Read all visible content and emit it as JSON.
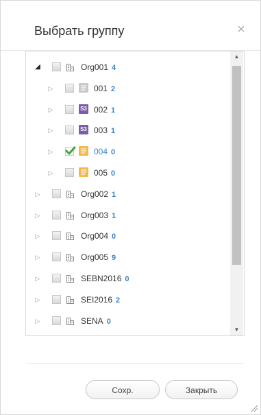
{
  "dialog": {
    "title": "Выбрать группу",
    "close_glyph": "×"
  },
  "tree": [
    {
      "level": 0,
      "expanded": true,
      "checked": false,
      "icon": "building-icon",
      "label": "Org001",
      "count": "4",
      "selected": false
    },
    {
      "level": 1,
      "expanded": false,
      "checked": false,
      "icon": "doc-gray-icon",
      "label": "001",
      "count": "2",
      "selected": false
    },
    {
      "level": 1,
      "expanded": false,
      "checked": false,
      "icon": "s3-icon",
      "label": "002",
      "count": "1",
      "selected": false
    },
    {
      "level": 1,
      "expanded": false,
      "checked": false,
      "icon": "s3-icon",
      "label": "003",
      "count": "1",
      "selected": false
    },
    {
      "level": 1,
      "expanded": false,
      "checked": true,
      "icon": "doc-yellow-icon",
      "label": "004",
      "count": "0",
      "selected": true
    },
    {
      "level": 1,
      "expanded": false,
      "checked": false,
      "icon": "doc-yellow-icon",
      "label": "005",
      "count": "0",
      "selected": false
    },
    {
      "level": 0,
      "expanded": false,
      "checked": false,
      "icon": "building-icon",
      "label": "Org002",
      "count": "1",
      "selected": false
    },
    {
      "level": 0,
      "expanded": false,
      "checked": false,
      "icon": "building-icon",
      "label": "Org003",
      "count": "1",
      "selected": false
    },
    {
      "level": 0,
      "expanded": false,
      "checked": false,
      "icon": "building-icon",
      "label": "Org004",
      "count": "0",
      "selected": false
    },
    {
      "level": 0,
      "expanded": false,
      "checked": false,
      "icon": "building-icon",
      "label": "Org005",
      "count": "9",
      "selected": false
    },
    {
      "level": 0,
      "expanded": false,
      "checked": false,
      "icon": "building-icon",
      "label": "SEBN2016",
      "count": "0",
      "selected": false
    },
    {
      "level": 0,
      "expanded": false,
      "checked": false,
      "icon": "building-icon",
      "label": "SEI2016",
      "count": "2",
      "selected": false
    },
    {
      "level": 0,
      "expanded": false,
      "checked": false,
      "icon": "building-icon",
      "label": "SENA",
      "count": "0",
      "selected": false
    }
  ],
  "icon_text": {
    "s3": "S3"
  },
  "buttons": {
    "save_label": "Сохр.",
    "close_label": "Закрыть"
  },
  "colors": {
    "accent": "#3a83c6",
    "folder_yellow": "#f3b94d",
    "s3_purple": "#7b5ca8",
    "check_green": "#3aa836"
  }
}
